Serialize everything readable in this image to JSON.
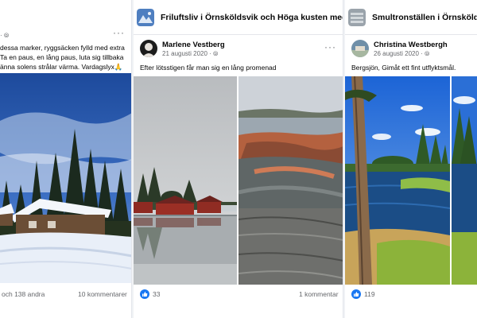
{
  "left_post": {
    "meta_dots": "· ⦾",
    "more": "···",
    "text_lines": [
      "dessa marker, ryggsäcken fylld med extra",
      "Ta en paus, en lång paus, luta sig tillbaka",
      "änna solens strålar värma. Vardagslyx🙏"
    ],
    "reactions_text": "och 138 andra",
    "comments_text": "10 kommentarer"
  },
  "mid_post": {
    "group_name": "Friluftsliv i Örnsköldsvik och Höga kusten med omnejd",
    "author": "Marlene Vestberg",
    "date": "21 augusti 2020 · ⦾",
    "more": "···",
    "text": "Efter lötsstigen får man sig en lång promenad",
    "like_count": "33",
    "comments_text": "1 kommentar"
  },
  "right_post": {
    "group_name": "Smultronställen i Örnsköldsvik m",
    "author": "Christina Westbergh",
    "date": "26 augusti 2020 · ⦾",
    "more": "···",
    "text": "Bergsjön, Gimåt ett fint utflyktsmål.",
    "like_count": "119"
  },
  "icons": {
    "like": "thumbs-up-icon",
    "more": "more-options-icon",
    "audience": "globe-icon"
  },
  "colors": {
    "like_blue": "#1877f2",
    "meta_gray": "#65676b"
  }
}
